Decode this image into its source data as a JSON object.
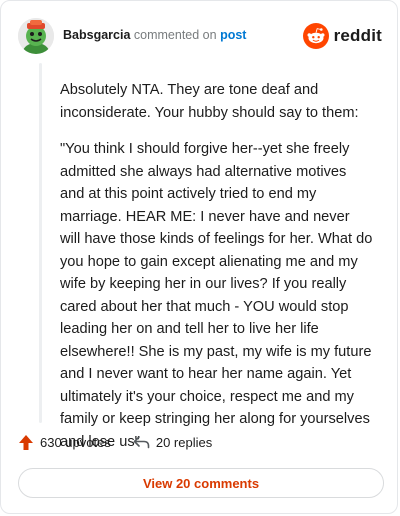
{
  "header": {
    "username": "Babsgarcia",
    "commented_text": "commented on",
    "post_link": "post",
    "brand": "reddit",
    "brand_color": "#ff4500"
  },
  "comment": {
    "paragraphs": [
      "Absolutely NTA. They are tone deaf and inconsiderate. Your hubby should say to them:",
      "\"You think I should forgive her--yet she freely admitted she always had alternative motives and at this point actively tried to end my marriage. HEAR ME: I never have and never will have those kinds of feelings for her. What do you hope to gain except alienating me and my wife by keeping her in our lives? If you really cared about her that much - YOU would stop leading her on and tell her to live her life elsewhere!! She is my past, my wife is my future and I never want to hear her name again. Yet ultimately it's your choice, respect me and my family or keep stringing her along for yourselves and lose us\""
    ]
  },
  "actions": {
    "upvotes": "630 upvotes",
    "replies": "20 replies",
    "upvote_icon": "upvote-arrow-icon",
    "reply_icon": "reply-arrow-icon"
  },
  "footer": {
    "view_button": "View 20 comments",
    "accent_color": "#d93a00"
  }
}
